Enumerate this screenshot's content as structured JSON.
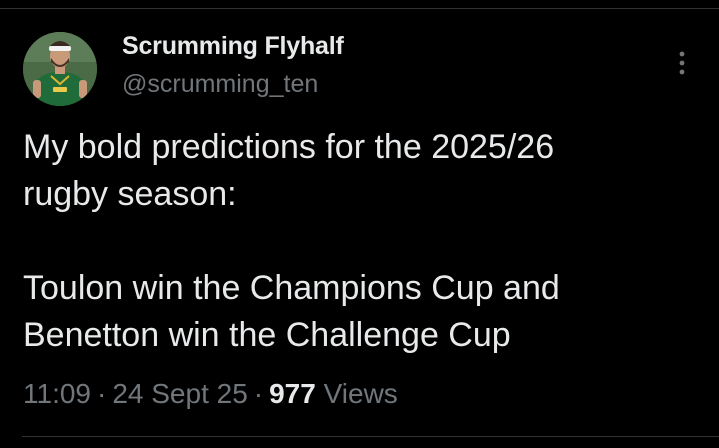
{
  "author": {
    "display_name": "Scrumming Flyhalf",
    "handle": "@scrumming_ten"
  },
  "tweet": {
    "lines": [
      "My bold predictions for the 2025/26",
      "rugby season:",
      "",
      "Toulon win the Champions Cup and",
      "Benetton win the Challenge Cup"
    ]
  },
  "meta": {
    "time": "11:09",
    "separator": "·",
    "date": "24 Sept 25",
    "views_count": "977",
    "views_label": "Views"
  },
  "icons": {
    "more": "more-vertical-icon",
    "avatar": "profile-avatar"
  },
  "colors": {
    "background": "#000000",
    "primary_text": "#e7e9ea",
    "secondary_text": "#71767b",
    "divider": "#2f3336"
  }
}
